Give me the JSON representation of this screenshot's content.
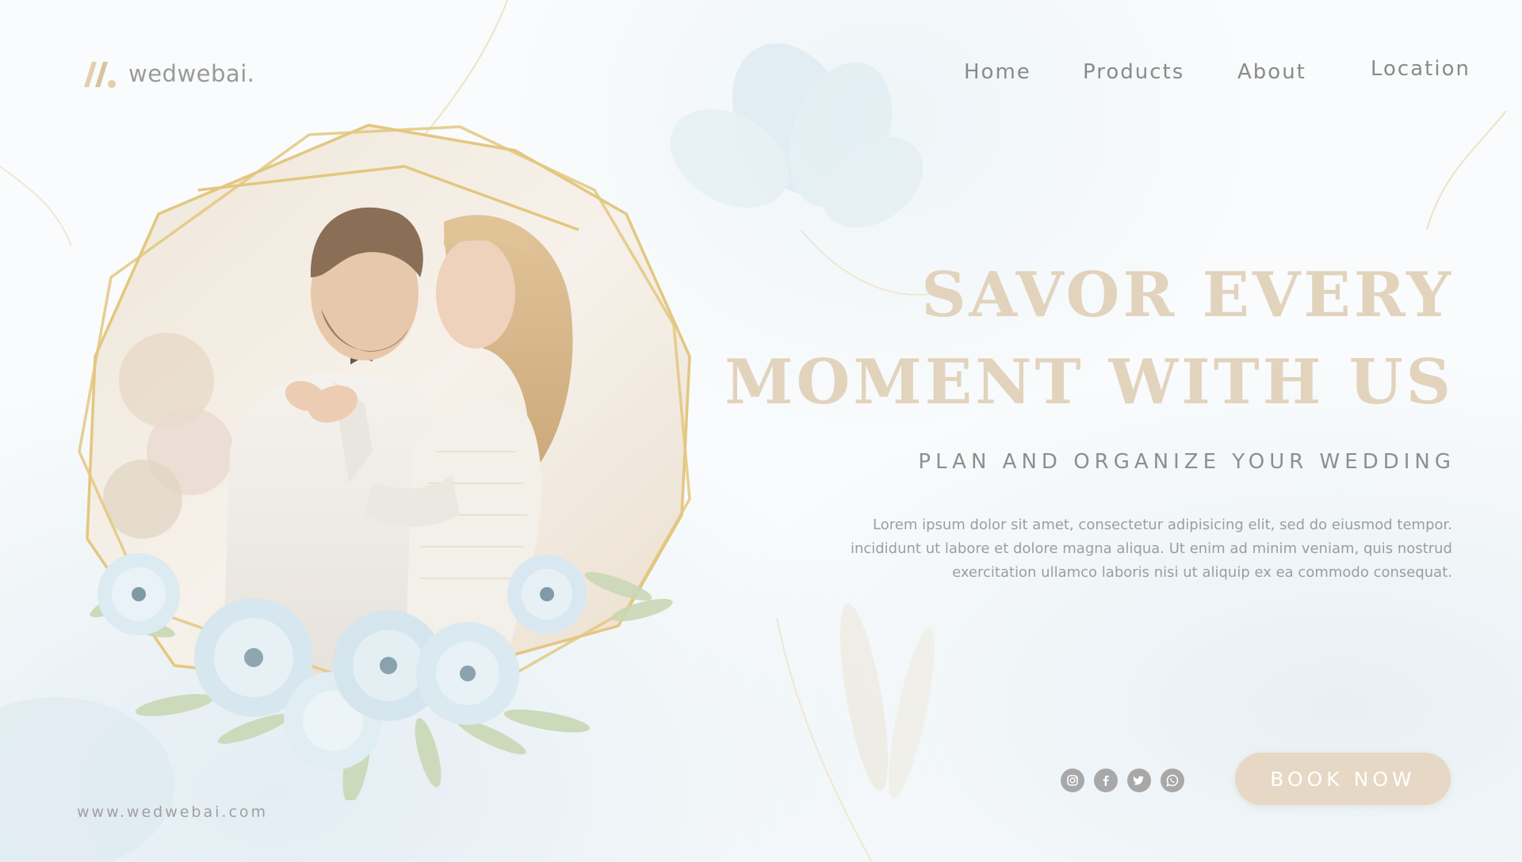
{
  "brand": {
    "name": "wedwebai.",
    "url": "www.wedwebai.com"
  },
  "nav": {
    "items": [
      {
        "label": "Home"
      },
      {
        "label": "Products"
      },
      {
        "label": "About"
      },
      {
        "label": "Location"
      }
    ]
  },
  "hero": {
    "headline_line1": "SAVOR EVERY",
    "headline_line2": "MOMENT WITH US",
    "subheadline": "PLAN AND ORGANIZE YOUR WEDDING",
    "body_line1": "Lorem ipsum dolor sit amet, consectetur adipisicing elit, sed do eiusmod tempor.",
    "body_line2": "incididunt ut labore et dolore magna aliqua. Ut enim ad minim veniam, quis nostrud",
    "body_line3": "exercitation ullamco laboris nisi ut aliquip ex ea commodo consequat."
  },
  "cta": {
    "book_label": "BOOK NOW"
  },
  "social": {
    "icons": [
      "instagram-icon",
      "facebook-icon",
      "twitter-icon",
      "whatsapp-icon"
    ]
  },
  "colors": {
    "accent_gold": "#e2d3bd",
    "button_fill": "#e6d8c4",
    "frame_gold": "#e3c77f",
    "flower_blue": "#d8e8f0",
    "text_gray": "#8e8e8e"
  }
}
